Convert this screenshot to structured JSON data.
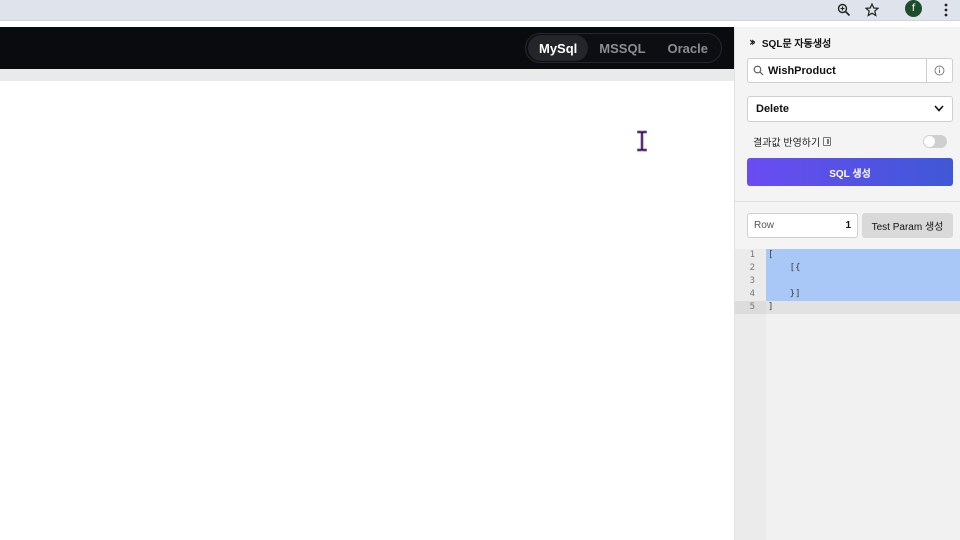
{
  "chrome": {
    "zoom_icon": "zoom-in-icon",
    "star_icon": "star-icon",
    "profile_initial": "f",
    "more_icon": "kebab-menu-icon"
  },
  "header": {
    "db_tabs": [
      "MySql",
      "MSSQL",
      "Oracle"
    ],
    "active_tab": "MySql"
  },
  "panel": {
    "title": "SQL문 자동생성",
    "search_value": "WishProduct",
    "query_type": "Delete",
    "toggle_label": "결과값 반영하기",
    "toggle_on": false,
    "generate_button": "SQL 생성",
    "row_label": "Row",
    "row_value": "1",
    "test_param_button": "Test Param 생성",
    "accent_from": "#6a4cf2",
    "accent_to": "#3f58d6"
  },
  "editor": {
    "lines": [
      {
        "num": "1",
        "code": "["
      },
      {
        "num": "2",
        "code": "    [{"
      },
      {
        "num": "3",
        "code": "    "
      },
      {
        "num": "4",
        "code": "    }]"
      },
      {
        "num": "5",
        "code": "]"
      }
    ]
  }
}
